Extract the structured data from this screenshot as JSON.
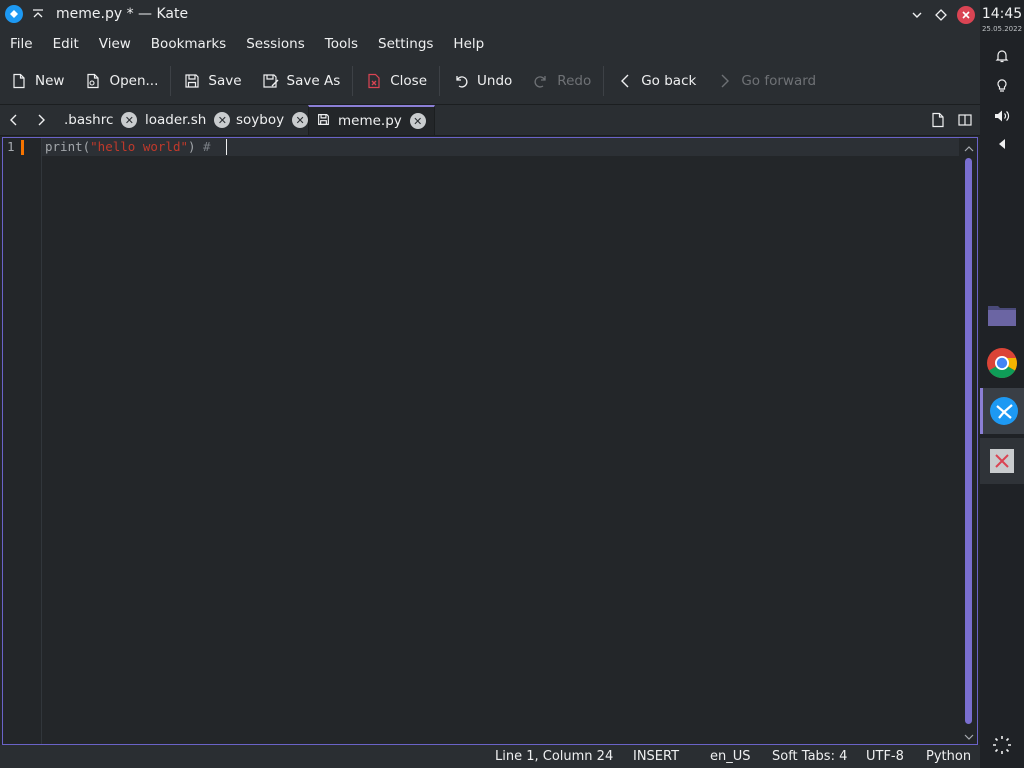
{
  "window": {
    "title": "meme.py * — Kate"
  },
  "menu": [
    "File",
    "Edit",
    "View",
    "Bookmarks",
    "Sessions",
    "Tools",
    "Settings",
    "Help"
  ],
  "toolbar": {
    "new": "New",
    "open": "Open...",
    "save": "Save",
    "save_as": "Save As",
    "close": "Close",
    "undo": "Undo",
    "redo": "Redo",
    "go_back": "Go back",
    "go_forward": "Go forward"
  },
  "tabs": [
    {
      "label": ".bashrc"
    },
    {
      "label": "loader.sh"
    },
    {
      "label": "soyboy"
    },
    {
      "label": "meme.py"
    }
  ],
  "editor": {
    "line_number": "1",
    "code": {
      "fn": "print(",
      "str": "\"hello world\"",
      "close": ")",
      "comment": " #"
    }
  },
  "status": {
    "position": "Line 1, Column 24",
    "mode": "INSERT",
    "dictionary": "en_US",
    "indent": "Soft Tabs: 4",
    "encoding": "UTF-8",
    "syntax": "Python"
  },
  "panel": {
    "time": "14:45",
    "date": "25.05.2022"
  },
  "colors": {
    "accent": "#8b7fd6",
    "close_red": "#da4453",
    "modified_marker": "#f67400",
    "string": "#c0392b"
  }
}
